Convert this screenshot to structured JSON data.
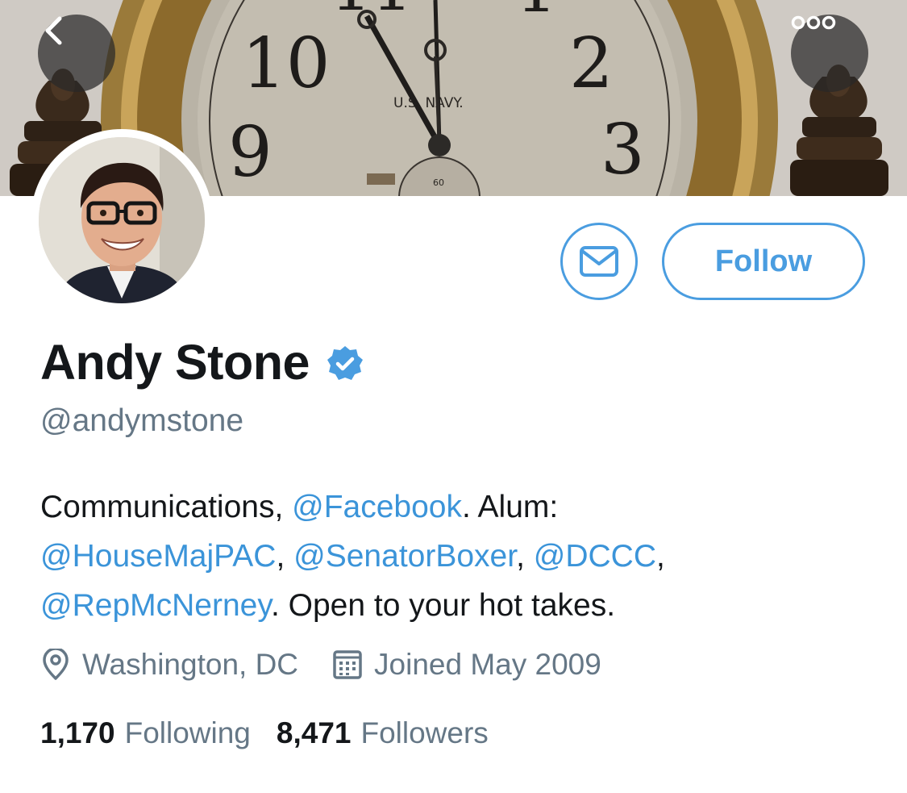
{
  "header": {
    "back_icon": "chevron-left-icon",
    "more_icon": "more-dots-icon",
    "banner_text": "U.S. NAVY."
  },
  "profile": {
    "display_name": "Andy Stone",
    "verified_icon": "verified-badge-icon",
    "handle": "@andymstone",
    "bio": [
      {
        "text": "Communications, ",
        "mention": false
      },
      {
        "text": "@Facebook",
        "mention": true
      },
      {
        "text": ". Alum: ",
        "mention": false
      },
      {
        "text": "@HouseMajPAC",
        "mention": true
      },
      {
        "text": ", ",
        "mention": false
      },
      {
        "text": "@SenatorBoxer",
        "mention": true
      },
      {
        "text": ", ",
        "mention": false
      },
      {
        "text": "@DCCC",
        "mention": true
      },
      {
        "text": ", ",
        "mention": false
      },
      {
        "text": "@RepMcNerney",
        "mention": true
      },
      {
        "text": ". Open to your hot takes.",
        "mention": false
      }
    ],
    "location": "Washington, DC",
    "joined": "Joined May 2009",
    "following_count": "1,170",
    "following_label": "Following",
    "followers_count": "8,471",
    "followers_label": "Followers"
  },
  "actions": {
    "follow_label": "Follow",
    "message_icon": "envelope-icon"
  },
  "colors": {
    "accent": "#4a9de0",
    "link": "#3b94d9",
    "secondary_text": "#657786",
    "primary_text": "#14171a"
  }
}
